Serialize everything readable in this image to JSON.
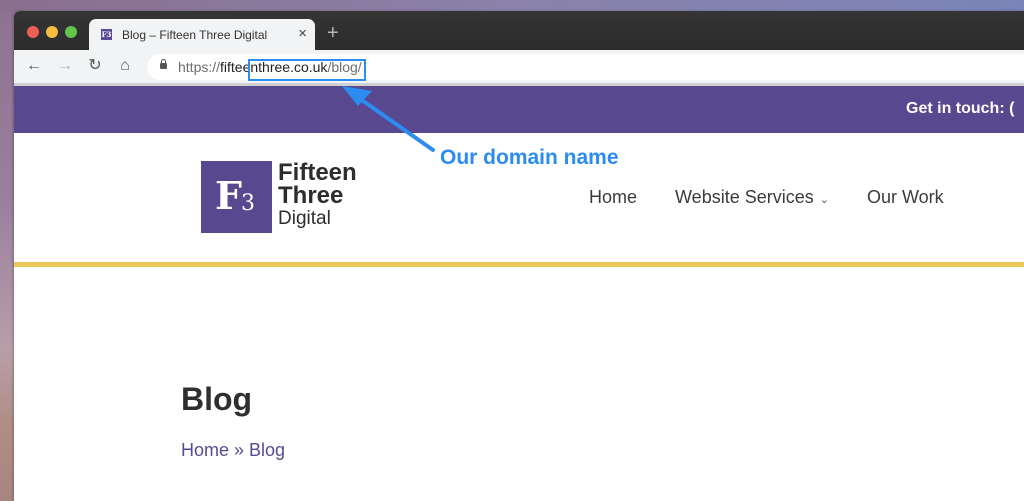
{
  "browser": {
    "tab": {
      "favicon_label": "F3",
      "title": "Blog – Fifteen Three Digital",
      "close_icon": "×"
    },
    "new_tab_icon": "+",
    "toolbar": {
      "back_icon": "←",
      "forward_icon": "→",
      "reload_icon": "↻",
      "home_icon": "⌂"
    },
    "url": {
      "scheme": "https://",
      "domain": "fifteenthree.co.uk",
      "path": "/blog/"
    }
  },
  "site": {
    "topbar_text": "Get in touch: (",
    "logo": {
      "mark_letter": "F",
      "mark_number": "3",
      "line1": "Fifteen",
      "line2": "Three",
      "line3": "Digital"
    },
    "nav": [
      {
        "label": "Home"
      },
      {
        "label": "Website Services",
        "chevron": "⌄"
      },
      {
        "label": "Our Work"
      }
    ],
    "page_title": "Blog",
    "breadcrumb": "Home » Blog"
  },
  "annotation": {
    "label": "Our domain name",
    "color": "#2c8cf2"
  },
  "colors": {
    "brand_purple": "#57488f",
    "accent_gold": "#e9c95a"
  }
}
